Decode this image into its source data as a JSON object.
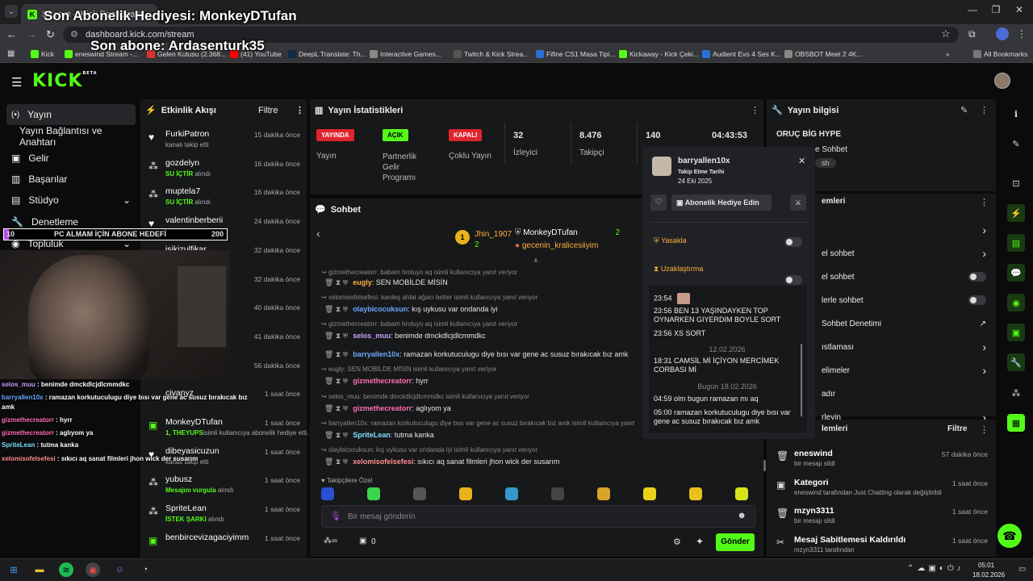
{
  "browser": {
    "tab_title": "Stream – Kick Dashboard",
    "url": "dashboard.kick.com/stream",
    "bookmarks": [
      "Kick",
      "eneswind Stream -...",
      "Gelen Kutusu (2.368...",
      "(41) YouTube",
      "DeepL Translate: Th...",
      "Interactive Games...",
      "Twitch & Kick Strea...",
      "Fifine CS1 Masa Tipi...",
      "Kickaway - Kick Çeki...",
      "Audient Evo 4 Ses K...",
      "OBSBOT Meet 2 4K..."
    ],
    "all_bookmarks": "All Bookmarks"
  },
  "overlay": {
    "last_gift": "Son Abonelik Hediyesi: MonkeyDTufan",
    "last_sub": "Son abone: Ardasenturk35",
    "goal_current": "10",
    "goal_text": "PC ALMAM İÇİN ABONE HEDEFİ",
    "goal_target": "200",
    "chat": [
      {
        "user": "selos_muu",
        "text": "benimde dmckdlcjdlcmmdkc",
        "color": "#c9a0ff"
      },
      {
        "user": "barryallen10x",
        "text": "ramazan korkutuculugu diye bısı var gene ac susuz bırakıcak bız amk",
        "color": "#6aa8ff"
      },
      {
        "user": "gizmethecreatorr",
        "text": "hyrr",
        "color": "#ff6fb5"
      },
      {
        "user": "gizmethecreatorr",
        "text": "aglıyom ya",
        "color": "#ff6fb5"
      },
      {
        "user": "SpriteLean",
        "text": "tutma kanka",
        "color": "#7fe0ff"
      },
      {
        "user": "xelomisofelsefesi",
        "text": "sıkıcı aq sanat filmleri jhon wick der susarım",
        "color": "#ff8f8f"
      }
    ]
  },
  "kick": {
    "logo": "KICK",
    "logo_beta": "BETA",
    "sidebar": [
      {
        "label": "Yayın",
        "icon": "broadcast-icon"
      },
      {
        "label": "Yayın Bağlantısı ve Anahtarı",
        "icon": ""
      },
      {
        "label": "Gelir",
        "icon": "revenue-icon"
      },
      {
        "label": "Başarılar",
        "icon": "achievements-icon"
      },
      {
        "label": "Stüdyo",
        "icon": "studio-icon"
      },
      {
        "label": "Denetleme",
        "icon": "moderation-icon"
      },
      {
        "label": "Topluluk",
        "icon": "community-icon"
      }
    ],
    "activity": {
      "title": "Etkinlik Akışı",
      "filter": "Filtre",
      "items": [
        {
          "name": "FurkiPatron",
          "sub": "kanalı takip etti",
          "hl": "",
          "time": "15 dakika önce",
          "icon": "heart"
        },
        {
          "name": "gozdelyn",
          "sub": " alındı",
          "hl": "SU İÇTİR",
          "time": "16 dakika önce",
          "icon": "points"
        },
        {
          "name": "muptela7",
          "sub": " alındı",
          "hl": "SU İÇTİR",
          "time": "16 dakika önce",
          "icon": "points"
        },
        {
          "name": "valentinberberii",
          "sub": "kanalı takip etti",
          "hl": "",
          "time": "24 dakika önce",
          "icon": "heart"
        },
        {
          "name": "isikizulfikar",
          "sub": "",
          "hl": "",
          "time": "32 dakika önce",
          "icon": "heart"
        },
        {
          "name": "",
          "sub": "",
          "hl": "",
          "time": "32 dakika önce",
          "icon": ""
        },
        {
          "name": "",
          "sub": "",
          "hl": "",
          "time": "40 dakika önce",
          "icon": ""
        },
        {
          "name": "",
          "sub": "",
          "hl": "",
          "time": "41 dakika önce",
          "icon": ""
        },
        {
          "name": "",
          "sub": "",
          "hl": "",
          "time": "56 dakika önce",
          "icon": ""
        },
        {
          "name": "civanyz",
          "sub": "",
          "hl": "",
          "time": "1 saat önce",
          "icon": ""
        },
        {
          "name": "MonkeyDTufan",
          "sub": "isimli kullanıcıya abonelik hediye etti.",
          "hl": "1, THEYUPS",
          "time": "1 saat önce",
          "icon": "gift"
        },
        {
          "name": "dibeyasicuzun",
          "sub": "kanalı takip etti",
          "hl": "",
          "time": "1 saat önce",
          "icon": "heart"
        },
        {
          "name": "yubusz",
          "sub": " alındı",
          "hl": "Mesajını vurgula",
          "time": "1 saat önce",
          "icon": "points"
        },
        {
          "name": "SpriteLean",
          "sub": " alındı",
          "hl": "İSTEK ŞARKI",
          "time": "1 saat önce",
          "icon": "points"
        },
        {
          "name": "benbircevizagaciyimm",
          "sub": "",
          "hl": "",
          "time": "1 saat önce",
          "icon": "gift"
        }
      ]
    },
    "stats": {
      "title": "Yayın İstatistikleri",
      "live_badge": "YAYINDA",
      "live_label": "Yayın",
      "partner_badge": "AÇIK",
      "partner_label": "Partnerlik Gelir Programı",
      "multi_badge": "KAPALI",
      "multi_label": "Çoklu Yayın",
      "viewers": "32",
      "viewers_label": "İzleyici",
      "followers": "8.476",
      "followers_label": "Takipçi",
      "subs": "140",
      "uptime": "04:43:53"
    },
    "chat": {
      "title": "Sohbet",
      "gifter1": "Jhin_1907",
      "gifter1_count": "2",
      "gifter2": "MonkeyDTufan",
      "gifter2_count": "2",
      "gifter3": "gecenin_kralicesiiyim",
      "gifter3_count": "1",
      "messages": [
        {
          "reply": "gizmethecreatorr: babam hroluyo aq isimli kullanıcıya yanıt veriyor",
          "user": "eugly",
          "text": "SEN MOBİLDE MİSİN",
          "color": "#ffb03a"
        },
        {
          "reply": "xelomisofelsefesi: kardeş ahlat ağacı better isimli kullanıcıya yanıt veriyor",
          "user": "olaybicocuksun",
          "text": "kış uykusu var ondanda iyi",
          "color": "#6aa8ff"
        },
        {
          "reply": "gizmethecreatorr: babam hroluyo aq isimli kullanıcıya yanıt veriyor",
          "user": "selos_muu",
          "text": "benimde dmckdlcjdlcmmdkc",
          "color": "#c9a0ff"
        },
        {
          "reply": "",
          "user": "barryallen10x",
          "text": "ramazan korkutuculugu diye bısı var gene ac susuz bırakıcak bız amk",
          "color": "#6aa8ff"
        },
        {
          "reply": "eugly: SEN MOBİLDE MİSİN isimli kullanıcıya yanıt veriyor",
          "user": "gizmethecreatorr",
          "text": "hyrr",
          "color": "#ff6fb5"
        },
        {
          "reply": "selos_muu: benimde dmckdlcjdlcmmdkc isimli kullanıcıya yanıt veriyor",
          "user": "gizmethecreatorr",
          "text": "aglıyom ya",
          "color": "#ff6fb5"
        },
        {
          "reply": "barryallen10x: ramazan korkutuculugu diye bısı var gene ac susuz bırakıcak bız amk isimli kullanıcıya yanıt veriyor",
          "user": "SpriteLean",
          "text": "tutma kanka",
          "color": "#7fe0ff"
        },
        {
          "reply": "olaybicocuksun: kış uykusu var ondanda iyi isimli kullanıcıya yanıt veriyor",
          "user": "xelomisofelsefesi",
          "text": "sıkıcı aq sanat filmleri jhon wick der susarım",
          "color": "#ff8f8f"
        }
      ],
      "emote_section": "Takipçilere Özel",
      "input_placeholder": "Bir mesaj gönderin",
      "points": "0",
      "send": "Gönder"
    },
    "popup": {
      "user": "barryallen10x",
      "follow_label": "Takip Etme Tarihi",
      "follow_date": "24 Eki 2025",
      "gift_sub": "Abonelik Hediye Edin",
      "ban": "Yasakla",
      "timeout": "Uzaklaştırma",
      "history": [
        {
          "type": "msg",
          "time": "23:54",
          "text": ""
        },
        {
          "type": "msg",
          "time": "23:56",
          "text": "BEN 13 YAŞINDAYKEN TOP OYNARKEN GIYERDIM BOYLE SORT"
        },
        {
          "type": "msg",
          "time": "23:56",
          "text": "XS SORT"
        },
        {
          "type": "date",
          "text": "12.02.2026"
        },
        {
          "type": "msg",
          "time": "18:31",
          "text": "CAMSİL Mİ İÇİYON MERCİMEK CORBASI Mİ"
        },
        {
          "type": "date",
          "text": "Bugün 18.02.2026"
        },
        {
          "type": "msg",
          "time": "04:59",
          "text": "olm bugun ramazan mı aq"
        },
        {
          "type": "msg",
          "time": "05:00",
          "text": "ramazan korkutuculugu diye bısı var gene ac susuz bırakıcak bız amk"
        }
      ]
    },
    "stream_info": {
      "title": "Yayın bilgisi",
      "stream_title": "ORUÇ BİG HYPE",
      "sohbet_partial": "e Sohbet",
      "chip": "sh"
    },
    "chat_settings": {
      "title_partial": "emleri",
      "items": [
        {
          "label": "",
          "control": "chevron"
        },
        {
          "label": "el sohbet",
          "control": "chevron"
        },
        {
          "label": "el sohbet",
          "control": "toggle"
        },
        {
          "label": "lerle sohbet",
          "control": "toggle"
        },
        {
          "label": "Sohbet Denetimi",
          "control": "external"
        },
        {
          "label": "ıstlaması",
          "control": "chevron"
        },
        {
          "label": "elimeler",
          "control": "chevron"
        },
        {
          "label": "adır",
          "control": ""
        },
        {
          "label": "rleyin",
          "control": "chevron"
        }
      ]
    },
    "mod_actions": {
      "title_partial": "lemleri",
      "filter": "Filtre",
      "items": [
        {
          "name": "eneswind",
          "sub": "bir mesajı sildi",
          "time": "57 dakika önce",
          "icon": "trash-icon"
        },
        {
          "name": "Kategori",
          "sub": "eneswind tarafından Just Chatting olarak değiştirildi",
          "time": "1 saat önce",
          "icon": "category-icon"
        },
        {
          "name": "mzyn3311",
          "sub": "bir mesajı sildi",
          "time": "1 saat önce",
          "icon": "trash-icon"
        },
        {
          "name": "Mesaj Sabitlemesi Kaldırıldı",
          "sub": "mzyn3311 tarafından",
          "time": "1 saat önce",
          "icon": "unpin-icon"
        }
      ]
    }
  },
  "taskbar": {
    "time": "05:01",
    "date": "18.02.2026"
  }
}
